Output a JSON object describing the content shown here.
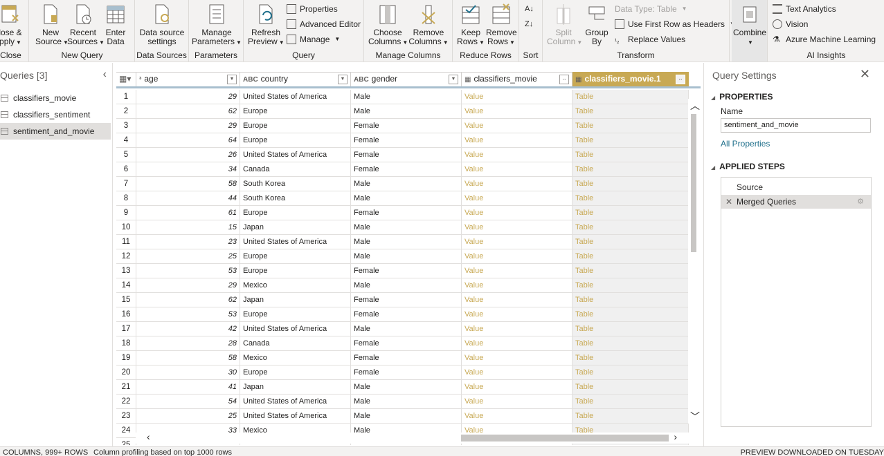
{
  "ribbon": {
    "close": {
      "btn": "lose &\npply",
      "group": "Close"
    },
    "new_query": {
      "group": "New Query",
      "new_source": "New\nSource",
      "recent_sources": "Recent\nSources",
      "enter_data": "Enter\nData"
    },
    "data_sources": {
      "group": "Data Sources",
      "settings": "Data source\nsettings"
    },
    "parameters": {
      "group": "Parameters",
      "manage": "Manage\nParameters"
    },
    "query": {
      "group": "Query",
      "refresh": "Refresh\nPreview",
      "properties": "Properties",
      "advanced_editor": "Advanced Editor",
      "manage": "Manage"
    },
    "manage_columns": {
      "group": "Manage Columns",
      "choose": "Choose\nColumns",
      "remove": "Remove\nColumns"
    },
    "reduce_rows": {
      "group": "Reduce Rows",
      "keep": "Keep\nRows",
      "remove": "Remove\nRows"
    },
    "sort": {
      "group": "Sort"
    },
    "transform": {
      "group": "Transform",
      "split": "Split\nColumn",
      "group_by": "Group\nBy",
      "data_type": "Data Type: Table",
      "first_row": "Use First Row as Headers",
      "replace": "Replace Values"
    },
    "combine": {
      "btn": "Combine"
    },
    "ai": {
      "group": "AI Insights",
      "text": "Text Analytics",
      "vision": "Vision",
      "azure": "Azure Machine Learning"
    }
  },
  "queries": {
    "title": "Queries [3]",
    "items": [
      "classifiers_movie",
      "classifiers_sentiment",
      "sentiment_and_movie"
    ],
    "selected": 2
  },
  "grid": {
    "headers": [
      {
        "type": "",
        "label": ""
      },
      {
        "type": "³",
        "label": "age"
      },
      {
        "type": "ABC",
        "label": "country"
      },
      {
        "type": "ABC",
        "label": "gender"
      },
      {
        "type": "",
        "label": "classifiers_movie"
      },
      {
        "type": "",
        "label": "classifiers_movie.1"
      }
    ],
    "rows": [
      [
        "1",
        "29",
        "United States of America",
        "Male",
        "Value",
        "Table"
      ],
      [
        "2",
        "62",
        "Europe",
        "Male",
        "Value",
        "Table"
      ],
      [
        "3",
        "29",
        "Europe",
        "Female",
        "Value",
        "Table"
      ],
      [
        "4",
        "64",
        "Europe",
        "Female",
        "Value",
        "Table"
      ],
      [
        "5",
        "26",
        "United States of America",
        "Female",
        "Value",
        "Table"
      ],
      [
        "6",
        "34",
        "Canada",
        "Female",
        "Value",
        "Table"
      ],
      [
        "7",
        "58",
        "South Korea",
        "Male",
        "Value",
        "Table"
      ],
      [
        "8",
        "44",
        "South Korea",
        "Male",
        "Value",
        "Table"
      ],
      [
        "9",
        "61",
        "Europe",
        "Female",
        "Value",
        "Table"
      ],
      [
        "10",
        "15",
        "Japan",
        "Male",
        "Value",
        "Table"
      ],
      [
        "11",
        "23",
        "United States of America",
        "Male",
        "Value",
        "Table"
      ],
      [
        "12",
        "25",
        "Europe",
        "Male",
        "Value",
        "Table"
      ],
      [
        "13",
        "53",
        "Europe",
        "Female",
        "Value",
        "Table"
      ],
      [
        "14",
        "29",
        "Mexico",
        "Male",
        "Value",
        "Table"
      ],
      [
        "15",
        "62",
        "Japan",
        "Female",
        "Value",
        "Table"
      ],
      [
        "16",
        "53",
        "Europe",
        "Female",
        "Value",
        "Table"
      ],
      [
        "17",
        "42",
        "United States of America",
        "Male",
        "Value",
        "Table"
      ],
      [
        "18",
        "28",
        "Canada",
        "Female",
        "Value",
        "Table"
      ],
      [
        "19",
        "58",
        "Mexico",
        "Female",
        "Value",
        "Table"
      ],
      [
        "20",
        "30",
        "Europe",
        "Female",
        "Value",
        "Table"
      ],
      [
        "21",
        "41",
        "Japan",
        "Male",
        "Value",
        "Table"
      ],
      [
        "22",
        "54",
        "United States of America",
        "Male",
        "Value",
        "Table"
      ],
      [
        "23",
        "25",
        "United States of America",
        "Male",
        "Value",
        "Table"
      ],
      [
        "24",
        "33",
        "Mexico",
        "Male",
        "Value",
        "Table"
      ],
      [
        "25",
        "",
        "",
        "",
        "",
        ""
      ]
    ]
  },
  "settings": {
    "title": "Query Settings",
    "properties": "PROPERTIES",
    "name_label": "Name",
    "name_value": "sentiment_and_movie",
    "all_properties": "All Properties",
    "applied_steps": "APPLIED STEPS",
    "steps": [
      "Source",
      "Merged Queries"
    ],
    "selected_step": 1
  },
  "status": {
    "columns": "COLUMNS, 999+ ROWS",
    "profiling": "Column profiling based on top 1000 rows",
    "preview": "PREVIEW DOWNLOADED ON TUESDAY"
  },
  "colors": {
    "accent": "#c8a954",
    "link": "#1f6f8b",
    "selection": "#e1dfdd"
  }
}
